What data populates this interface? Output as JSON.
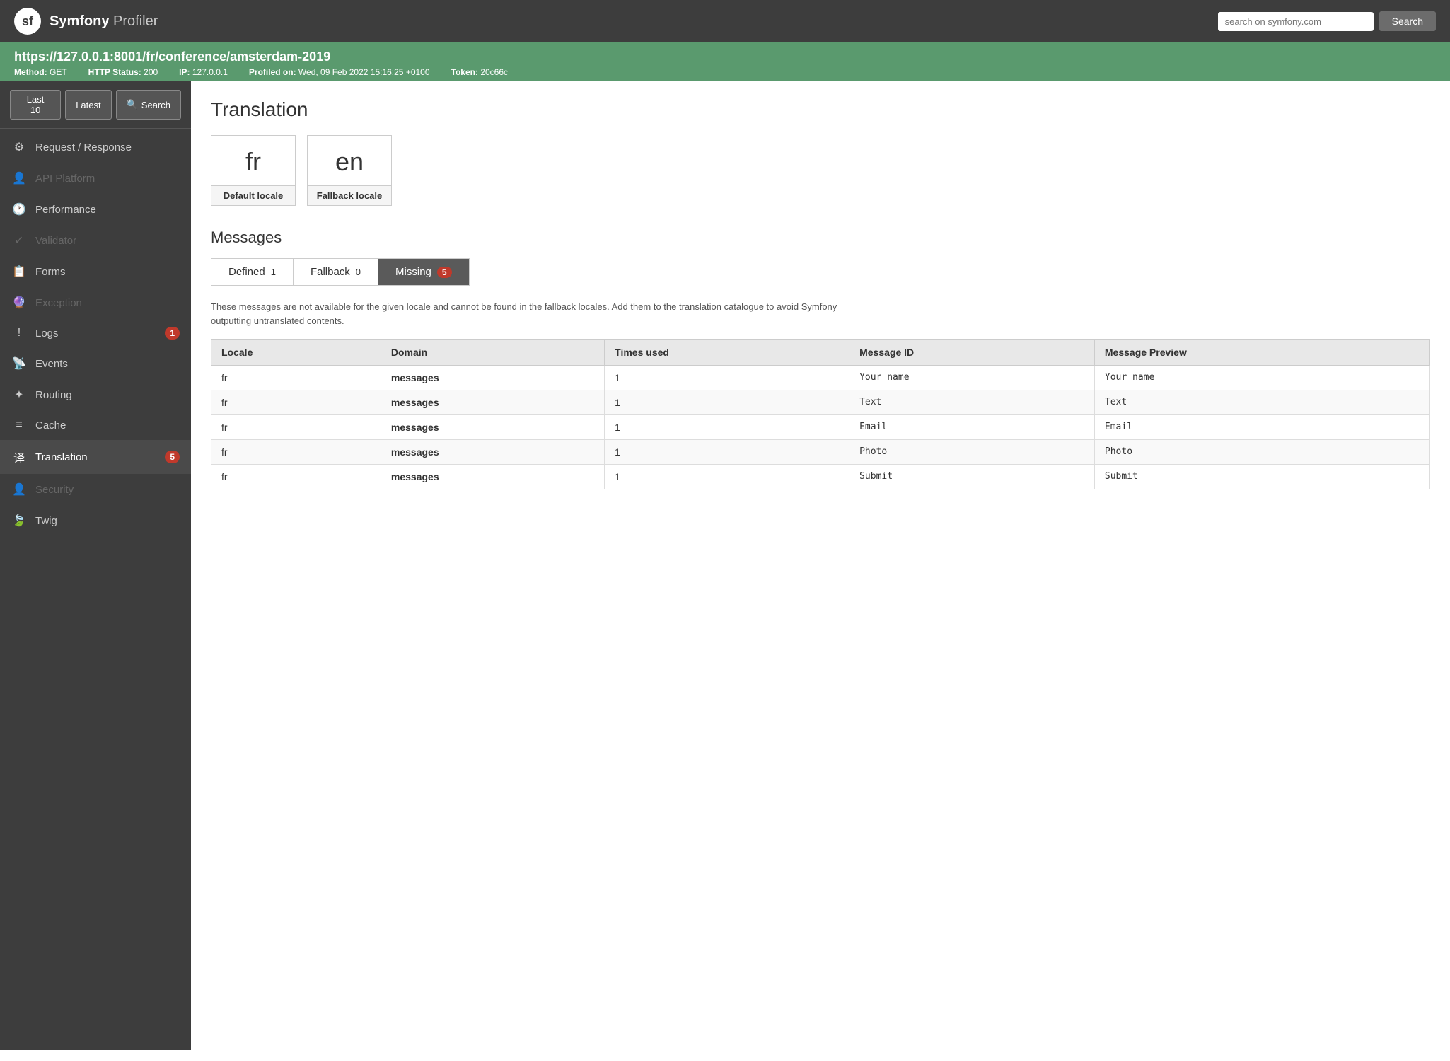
{
  "topbar": {
    "brand_symfony": "Symfony",
    "brand_profiler": "Profiler",
    "search_placeholder": "search on symfony.com",
    "search_button": "Search"
  },
  "urlbar": {
    "url": "https://127.0.0.1:8001/fr/conference/amsterdam-2019",
    "method_label": "Method:",
    "method_value": "GET",
    "status_label": "HTTP Status:",
    "status_value": "200",
    "ip_label": "IP:",
    "ip_value": "127.0.0.1",
    "profiled_label": "Profiled on:",
    "profiled_value": "Wed, 09 Feb 2022 15:16:25 +0100",
    "token_label": "Token:",
    "token_value": "20c66c"
  },
  "sidebar": {
    "toolbar_last10": "Last 10",
    "toolbar_latest": "Latest",
    "toolbar_search": "Search",
    "items": [
      {
        "id": "request-response",
        "label": "Request / Response",
        "icon": "⚙",
        "active": false,
        "disabled": false,
        "badge": null
      },
      {
        "id": "api-platform",
        "label": "API Platform",
        "icon": "👤",
        "active": false,
        "disabled": true,
        "badge": null
      },
      {
        "id": "performance",
        "label": "Performance",
        "icon": "🕐",
        "active": false,
        "disabled": false,
        "badge": null
      },
      {
        "id": "validator",
        "label": "Validator",
        "icon": "✓",
        "active": false,
        "disabled": true,
        "badge": null
      },
      {
        "id": "forms",
        "label": "Forms",
        "icon": "📋",
        "active": false,
        "disabled": false,
        "badge": null
      },
      {
        "id": "exception",
        "label": "Exception",
        "icon": "🔮",
        "active": false,
        "disabled": true,
        "badge": null
      },
      {
        "id": "logs",
        "label": "Logs",
        "icon": "!",
        "active": false,
        "disabled": false,
        "badge": "1"
      },
      {
        "id": "events",
        "label": "Events",
        "icon": "📡",
        "active": false,
        "disabled": false,
        "badge": null
      },
      {
        "id": "routing",
        "label": "Routing",
        "icon": "✦",
        "active": false,
        "disabled": false,
        "badge": null
      },
      {
        "id": "cache",
        "label": "Cache",
        "icon": "≡",
        "active": false,
        "disabled": false,
        "badge": null
      },
      {
        "id": "translation",
        "label": "Translation",
        "icon": "译",
        "active": true,
        "disabled": false,
        "badge": "5"
      },
      {
        "id": "security",
        "label": "Security",
        "icon": "👤",
        "active": false,
        "disabled": true,
        "badge": null
      },
      {
        "id": "twig",
        "label": "Twig",
        "icon": "🍃",
        "active": false,
        "disabled": false,
        "badge": null
      }
    ]
  },
  "content": {
    "page_title": "Translation",
    "default_locale_label": "Default locale",
    "default_locale_value": "fr",
    "fallback_locale_label": "Fallback locale",
    "fallback_locale_value": "en",
    "messages_title": "Messages",
    "tabs": [
      {
        "id": "defined",
        "label": "Defined",
        "count": "1",
        "active": false,
        "badge_type": "plain"
      },
      {
        "id": "fallback",
        "label": "Fallback",
        "count": "0",
        "active": false,
        "badge_type": "plain"
      },
      {
        "id": "missing",
        "label": "Missing",
        "count": "5",
        "active": true,
        "badge_type": "red"
      }
    ],
    "info_text": "These messages are not available for the given locale and cannot be found in the fallback locales. Add them to the translation catalogue to avoid Symfony outputting untranslated contents.",
    "table_headers": [
      "Locale",
      "Domain",
      "Times used",
      "Message ID",
      "Message Preview"
    ],
    "table_rows": [
      {
        "locale": "fr",
        "domain": "messages",
        "times_used": "1",
        "message_id": "Your name",
        "message_preview": "Your name"
      },
      {
        "locale": "fr",
        "domain": "messages",
        "times_used": "1",
        "message_id": "Text",
        "message_preview": "Text"
      },
      {
        "locale": "fr",
        "domain": "messages",
        "times_used": "1",
        "message_id": "Email",
        "message_preview": "Email"
      },
      {
        "locale": "fr",
        "domain": "messages",
        "times_used": "1",
        "message_id": "Photo",
        "message_preview": "Photo"
      },
      {
        "locale": "fr",
        "domain": "messages",
        "times_used": "1",
        "message_id": "Submit",
        "message_preview": "Submit"
      }
    ]
  }
}
